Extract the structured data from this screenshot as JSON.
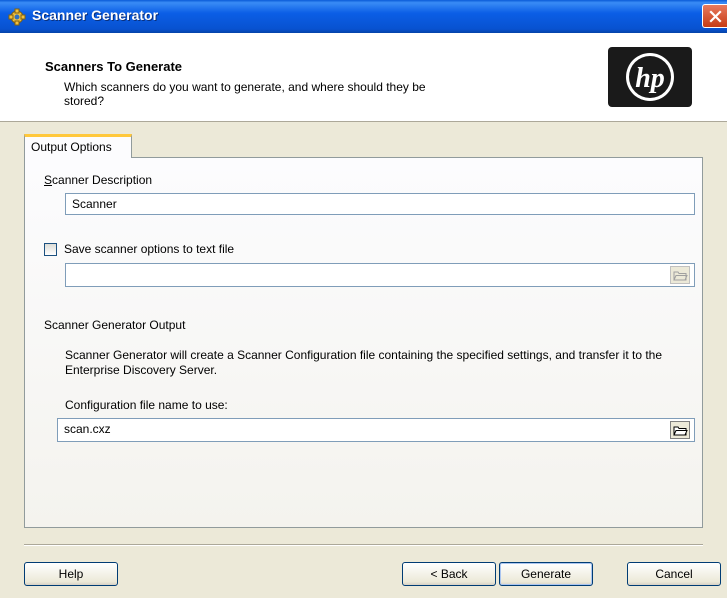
{
  "window": {
    "title": "Scanner Generator"
  },
  "header": {
    "title": "Scanners To Generate",
    "subtitle": "Which scanners do you want to generate, and where should they be stored?",
    "logo_text": "hp"
  },
  "tab": {
    "label": "Output Options"
  },
  "form": {
    "description_label": "Scanner Description",
    "description_value": "Scanner",
    "save_options_label": "Save scanner options to text file",
    "save_options_checked": false,
    "save_options_path": "",
    "output_section_label": "Scanner Generator Output",
    "output_info": "Scanner Generator will create a Scanner Configuration file containing the specified settings, and transfer it to the Enterprise Discovery Server.",
    "config_label": "Configuration file name to use:",
    "config_value": "scan.cxz"
  },
  "buttons": {
    "help": "Help",
    "back": "< Back",
    "generate": "Generate",
    "cancel": "Cancel"
  },
  "colors": {
    "titlebar": "#0b5ee6",
    "tab_highlight": "#ffc83c",
    "dialog_bg": "#ece9d8"
  }
}
